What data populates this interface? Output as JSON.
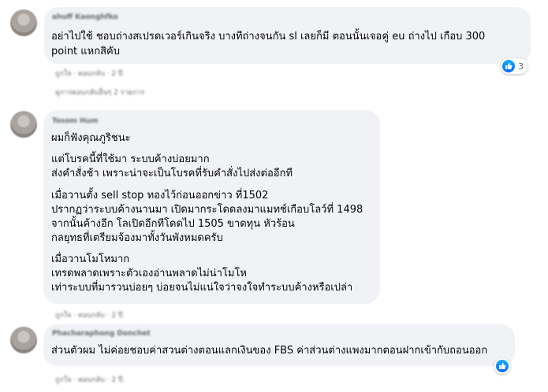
{
  "comments": [
    {
      "author": "ahuff Kaonghfko",
      "lines": [
        "อย่าไปใช้ ชอบถ่างสเปรดเวอร์เกินจริง บางทีถ่างจนกัน sl เลยก็มี ตอนนั้นเจอคู่ eu ถ่างไป เกือบ 300",
        "point แหกสิคับ"
      ],
      "actions": "ถูกใจ · ตอบกลับ · 2 ปี",
      "reaction_count": "3",
      "replies": "ดูการตอบกลับอื่นๆ 2 รายการ"
    },
    {
      "author": "Tosom Hum",
      "lines": [
        "ผมก็ฟังคุณภูริชนะ",
        "แต่โบรคนี้ที่ใช้มา ระบบค้างบ่อยมาก",
        "ส่งคำสั่งช้า เพราะน่าจะเป็นโบรคที่รับคำสั่งไปส่งต่ออีกที",
        "เมื่อวานตั้ง sell stop ทองไว้ก่อนออกข่าว ที่1502",
        "ปรากฏว่าระบบค้างนานมา เปิดมากระโดดลงมาแมทช์เกือบโลว์ที่ 1498",
        "จากนั้นค้างอีก โลเปิดอีกทีโดดไป 1505 ขาดทุน หัวร้อน",
        "กลยุทธที่เตรียมจ้องมาทั้งวันพังหมดครับ",
        "เมื่อวานโมโหมาก",
        "เทรดพลาดเพราะตัวเองอ่านพลาดไม่น่าโมโห",
        "เท่าระบบที่มารวนบ่อยๆ บ่อยจนไม่แน่ใจว่าจงใจทำระบบค้างหรือเปล่า"
      ],
      "actions": "ถูกใจ · ตอบกลับ · 2 ปี"
    },
    {
      "author": "Phacharaphong Donchet",
      "lines": [
        "ส่วนตัวผม ไม่ค่อยชอบค่าสวนต่างตอนแลกเงินของ FBS ค่าส่วนต่างแพงมากตอนฝากเข้ากับถอนออก"
      ],
      "actions": "ถูกใจ · ตอบกลับ · 2 ปี"
    }
  ],
  "colors": {
    "bubble": "#f0f2f5",
    "like": "#0866ff"
  },
  "icons": {
    "reaction": "like-thumb-icon"
  }
}
